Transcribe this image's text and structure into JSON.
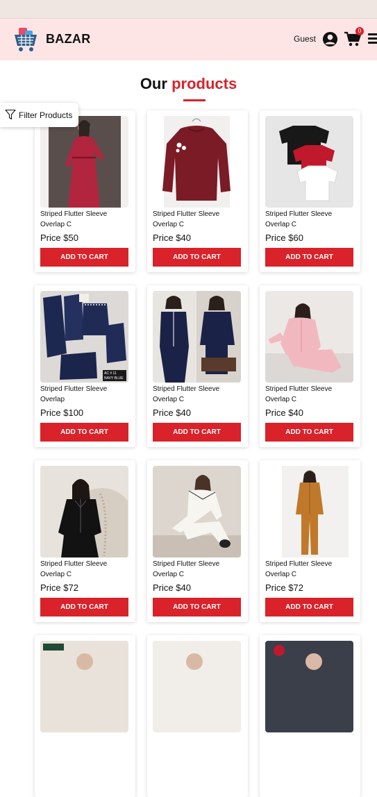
{
  "header": {
    "brand": "BAZAR",
    "user_label": "Guest",
    "cart_count": "0",
    "accent_color": "#d9222a",
    "header_bg": "#fde5e5"
  },
  "section": {
    "title_plain": "Our",
    "title_accent": "products"
  },
  "filter": {
    "label": "Filter Products"
  },
  "products": [
    {
      "name": "Striped Flutter Sleeve Overlap C",
      "price": "Price $50",
      "button": "ADD TO CART",
      "image": "red-lace-dress"
    },
    {
      "name": "Striped Flutter Sleeve Overlap C",
      "price": "Price $40",
      "button": "ADD TO CART",
      "image": "maroon-sweatshirt"
    },
    {
      "name": "Striped Flutter Sleeve Overlap C",
      "price": "Price $60",
      "button": "ADD TO CART",
      "image": "three-tshirts"
    },
    {
      "name": "Striped Flutter Sleeve Overlap",
      "price": "Price $100",
      "button": "ADD TO CART",
      "image": "navy-nightwear-set"
    },
    {
      "name": "Striped Flutter Sleeve Overlap C",
      "price": "Price $40",
      "button": "ADD TO CART",
      "image": "navy-pajamas"
    },
    {
      "name": "Striped Flutter Sleeve Overlap C",
      "price": "Price $40",
      "button": "ADD TO CART",
      "image": "pink-pajamas"
    },
    {
      "name": "Striped Flutter Sleeve Overlap C",
      "price": "Price $72",
      "button": "ADD TO CART",
      "image": "black-satin-pajamas"
    },
    {
      "name": "Striped Flutter Sleeve Overlap C",
      "price": "Price $40",
      "button": "ADD TO CART",
      "image": "white-pajamas"
    },
    {
      "name": "Striped Flutter Sleeve Overlap C",
      "price": "Price $72",
      "button": "ADD TO CART",
      "image": "mustard-pajamas"
    },
    {
      "name": "",
      "price": "",
      "button": "",
      "image": "partial-1"
    },
    {
      "name": "",
      "price": "",
      "button": "",
      "image": "partial-2"
    },
    {
      "name": "",
      "price": "",
      "button": "",
      "image": "partial-3"
    }
  ]
}
